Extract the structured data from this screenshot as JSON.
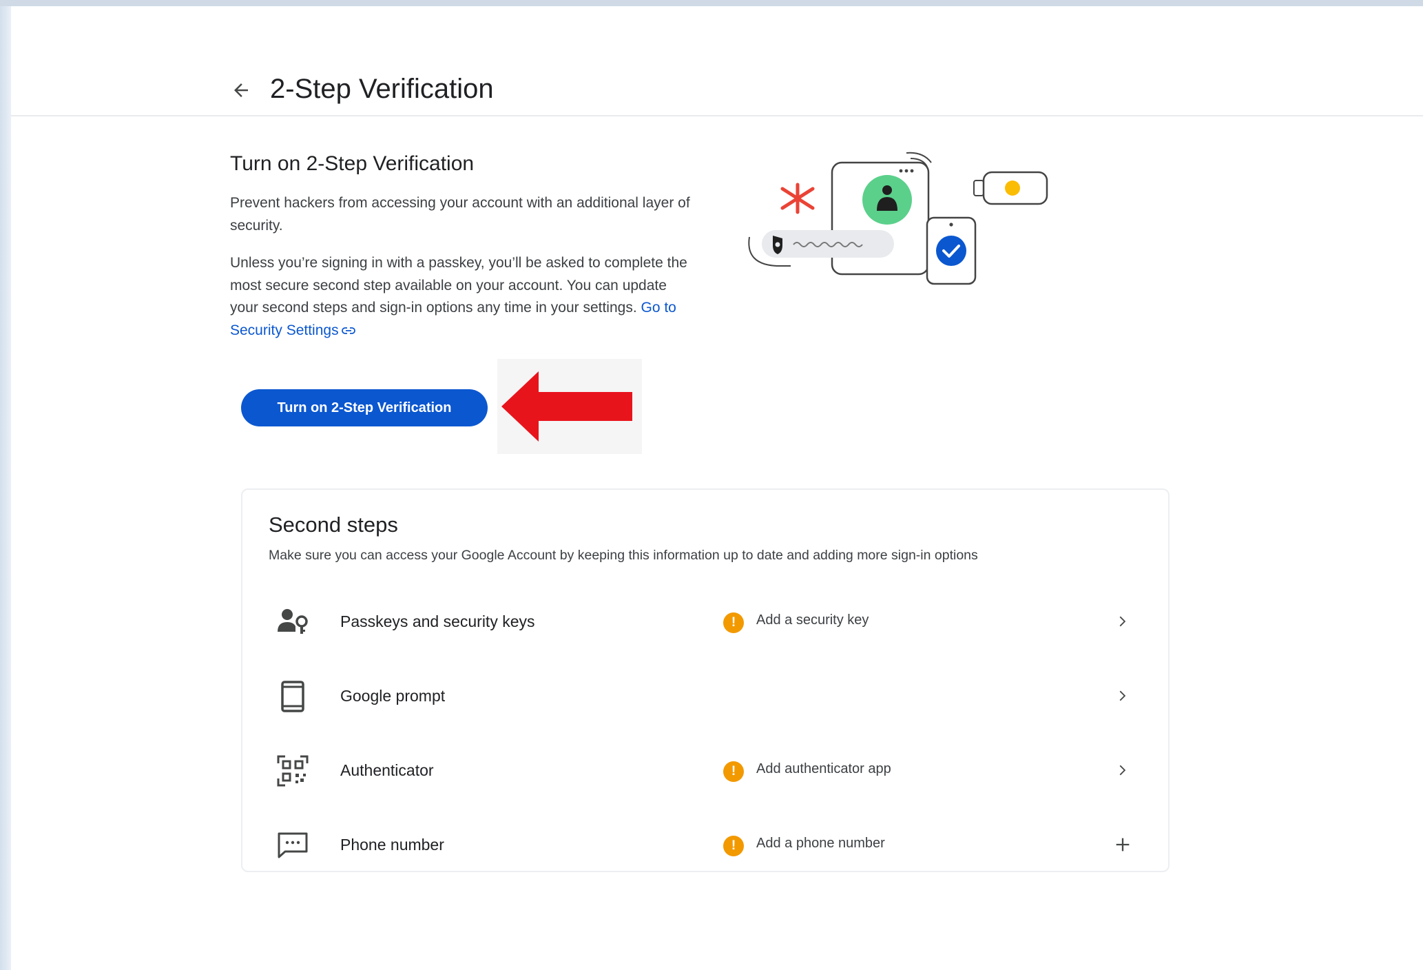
{
  "header": {
    "title": "2-Step Verification"
  },
  "intro": {
    "heading": "Turn on 2-Step Verification",
    "paragraph1": "Prevent hackers from accessing your account with an additional layer of security.",
    "paragraph2": "Unless you’re signing in with a passkey, you’ll be asked to complete the most secure second step available on your account. You can update your second steps and sign-in options any time in your settings.",
    "link_text": "Go to Security Settings",
    "button_label": "Turn on 2-Step Verification"
  },
  "second_steps": {
    "title": "Second steps",
    "description": "Make sure you can access your Google Account by keeping this information up to date and adding more sign-in options",
    "items": [
      {
        "label": "Passkeys and security keys",
        "status": "Add a security key",
        "icon": "passkey-icon",
        "action": "chevron-right-icon"
      },
      {
        "label": "Google prompt",
        "status": "",
        "icon": "phone-icon",
        "action": "chevron-right-icon"
      },
      {
        "label": "Authenticator",
        "status": "Add authenticator app",
        "icon": "qr-code-icon",
        "action": "chevron-right-icon"
      },
      {
        "label": "Phone number",
        "status": "Add a phone number",
        "icon": "message-icon",
        "action": "plus-icon"
      }
    ]
  },
  "colors": {
    "primary": "#0b57d0",
    "warning": "#f29900",
    "annotation_arrow": "#e8141c",
    "illustration_green": "#5bd08b",
    "illustration_red": "#ea4335",
    "illustration_yellow": "#fbbc04"
  }
}
